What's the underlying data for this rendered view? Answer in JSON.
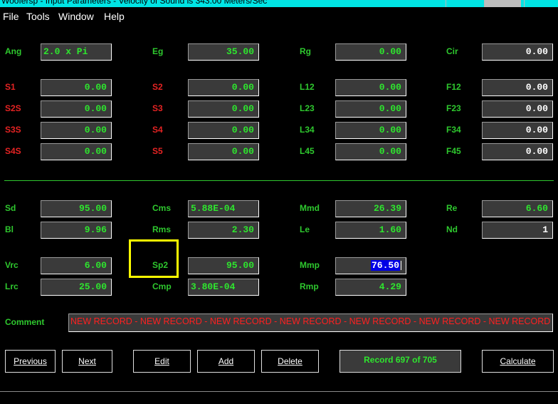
{
  "window": {
    "title": "Woofersp - Input Parameters - Velocity of Sound is 343.00 Meters/Sec"
  },
  "menu": [
    "File",
    "Tools",
    "Window",
    "Help"
  ],
  "params": {
    "ang": {
      "label": "Ang",
      "value": "2.0 x Pi"
    },
    "eg": {
      "label": "Eg",
      "value": "35.00"
    },
    "rg": {
      "label": "Rg",
      "value": "0.00"
    },
    "cir": {
      "label": "Cir",
      "value": "0.00"
    },
    "s1": {
      "label": "S1",
      "value": "0.00"
    },
    "s2": {
      "label": "S2",
      "value": "0.00"
    },
    "l12": {
      "label": "L12",
      "value": "0.00"
    },
    "f12": {
      "label": "F12",
      "value": "0.00"
    },
    "s2s": {
      "label": "S2S",
      "value": "0.00"
    },
    "s3": {
      "label": "S3",
      "value": "0.00"
    },
    "l23": {
      "label": "L23",
      "value": "0.00"
    },
    "f23": {
      "label": "F23",
      "value": "0.00"
    },
    "s3s": {
      "label": "S3S",
      "value": "0.00"
    },
    "s4": {
      "label": "S4",
      "value": "0.00"
    },
    "l34": {
      "label": "L34",
      "value": "0.00"
    },
    "f34": {
      "label": "F34",
      "value": "0.00"
    },
    "s4s": {
      "label": "S4S",
      "value": "0.00"
    },
    "s5": {
      "label": "S5",
      "value": "0.00"
    },
    "l45": {
      "label": "L45",
      "value": "0.00"
    },
    "f45": {
      "label": "F45",
      "value": "0.00"
    },
    "sd": {
      "label": "Sd",
      "value": "95.00"
    },
    "cms": {
      "label": "Cms",
      "value": "5.88E-04"
    },
    "mmd": {
      "label": "Mmd",
      "value": "26.39"
    },
    "re": {
      "label": "Re",
      "value": "6.60"
    },
    "bl": {
      "label": "Bl",
      "value": "9.96"
    },
    "rms": {
      "label": "Rms",
      "value": "2.30"
    },
    "le": {
      "label": "Le",
      "value": "1.60"
    },
    "nd": {
      "label": "Nd",
      "value": "1"
    },
    "vrc": {
      "label": "Vrc",
      "value": "6.00"
    },
    "sp2": {
      "label": "Sp2",
      "value": "95.00"
    },
    "mmp": {
      "label": "Mmp",
      "value": "76.50"
    },
    "lrc": {
      "label": "Lrc",
      "value": "25.00"
    },
    "cmp": {
      "label": "Cmp",
      "value": "3.80E-04"
    },
    "rmp": {
      "label": "Rmp",
      "value": "4.29"
    }
  },
  "comment": {
    "label": "Comment",
    "value": "NEW RECORD - NEW RECORD - NEW RECORD - NEW RECORD - NEW RECORD - NEW RECORD - NEW RECORD"
  },
  "buttons": {
    "previous": "Previous",
    "next": "Next",
    "edit": "Edit",
    "add": "Add",
    "delete": "Delete",
    "record": "Record 697 of 705",
    "calculate": "Calculate"
  },
  "colors": {
    "label_green": "#2ec82e",
    "label_red": "#e52323",
    "field_bg": "#3a3a3a",
    "highlight_yellow": "#ffff00",
    "selection_blue": "#0000e6"
  }
}
